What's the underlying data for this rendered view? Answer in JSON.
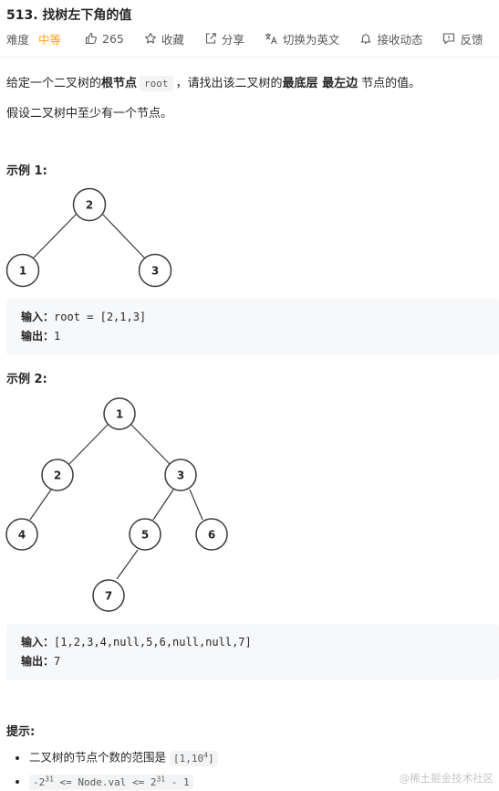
{
  "problem": {
    "title": "513. 找树左下角的值"
  },
  "toolbar": {
    "difficulty_label": "难度",
    "difficulty_value": "中等",
    "likes": "265",
    "favorite": "收藏",
    "share": "分享",
    "switch_lang": "切换为英文",
    "notify": "接收动态",
    "feedback": "反馈"
  },
  "description": {
    "p1_a": "给定一个二叉树的",
    "p1_bold1": "根节点",
    "p1_code": "root",
    "p1_b": "，请找出该二叉树的",
    "p1_bold2": "最底层 最左边",
    "p1_c": "节点的值。",
    "p2": "假设二叉树中至少有一个节点。"
  },
  "example1": {
    "title": "示例 1:",
    "tree_nodes": [
      "2",
      "1",
      "3"
    ],
    "input_label": "输入：",
    "input_value": "root = [2,1,3]",
    "output_label": "输出：",
    "output_value": "1"
  },
  "example2": {
    "title": "示例 2:",
    "tree_nodes": [
      "1",
      "2",
      "3",
      "4",
      "5",
      "6",
      "7"
    ],
    "input_label": "输入：",
    "input_value": "[1,2,3,4,null,5,6,null,null,7]",
    "output_label": "输出：",
    "output_value": "7"
  },
  "hints": {
    "title": "提示:",
    "h1_text": "二叉树的节点个数的范围是",
    "h1_code_a": "[1,10",
    "h1_code_sup": "4",
    "h1_code_b": "]",
    "h2_a": "-2",
    "h2_sup1": "31",
    "h2_mid": " <= Node.val <= 2",
    "h2_sup2": "31",
    "h2_end": " - 1"
  },
  "watermark": "@稀土掘金技术社区"
}
